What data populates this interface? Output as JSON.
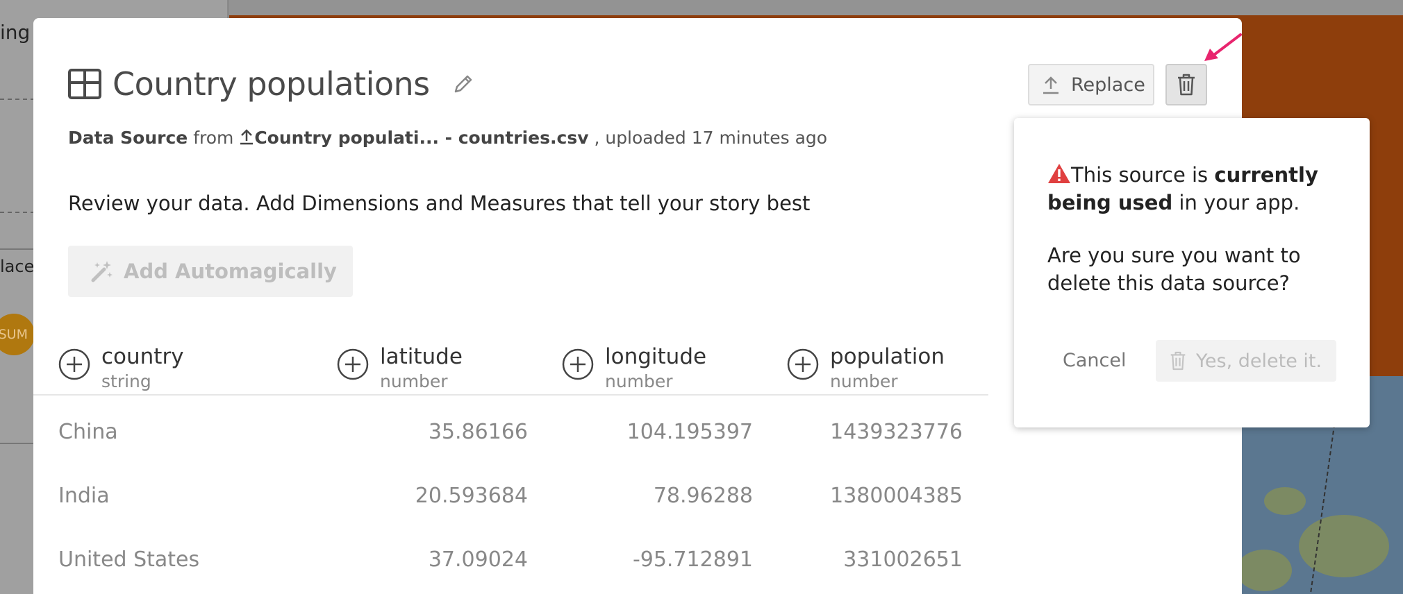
{
  "background": {
    "fragments": [
      "ing",
      "lace",
      "SUM"
    ]
  },
  "modal": {
    "title": "Country populations",
    "subtitle": {
      "prefix": "Data Source",
      "from": "from",
      "file": "Country populati... - countries.csv",
      "suffix": ", uploaded 17 minutes ago"
    },
    "intro": "Review your data. Add Dimensions and Measures that tell your story best",
    "add_auto_label": "Add Automagically",
    "replace_label": "Replace"
  },
  "table": {
    "columns": [
      {
        "name": "country",
        "type": "string"
      },
      {
        "name": "latitude",
        "type": "number"
      },
      {
        "name": "longitude",
        "type": "number"
      },
      {
        "name": "population",
        "type": "number"
      }
    ],
    "rows": [
      [
        "China",
        "35.86166",
        "104.195397",
        "1439323776"
      ],
      [
        "India",
        "20.593684",
        "78.96288",
        "1380004385"
      ],
      [
        "United States",
        "37.09024",
        "-95.712891",
        "331002651"
      ]
    ]
  },
  "popover": {
    "warn_prefix": "This source is ",
    "warn_bold": "currently being used",
    "warn_suffix": " in your app.",
    "question": "Are you sure you want to delete this data source?",
    "cancel_label": "Cancel",
    "confirm_label": "Yes, delete it."
  },
  "colors": {
    "accent_pink": "#e8256e",
    "warning_red": "#e04040",
    "background_orange": "#8e3e0c"
  }
}
